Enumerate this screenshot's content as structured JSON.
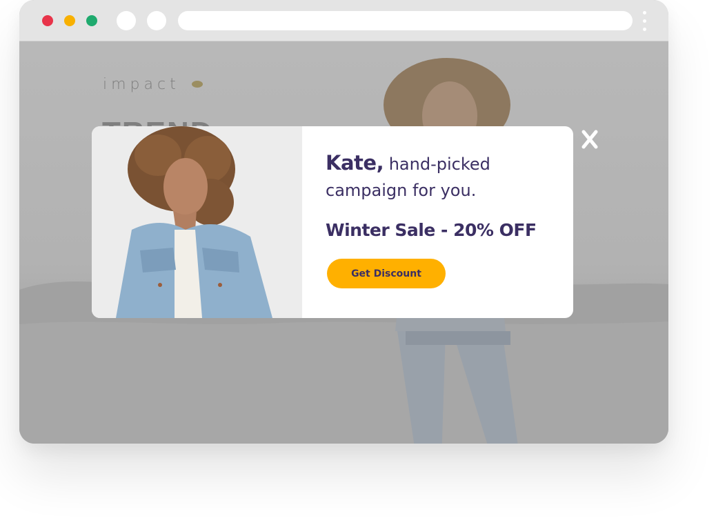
{
  "browser": {
    "traffic_lights": {
      "red": "#e8344a",
      "yellow": "#f8b000",
      "green": "#1faa6e"
    },
    "back_icon": "circle-button",
    "forward_icon": "circle-button",
    "url": "",
    "menu_icon": "kebab-menu-icon"
  },
  "background_page": {
    "logo": "impact",
    "headline": "TREND"
  },
  "popup": {
    "name": "Kate,",
    "message": " hand-picked campaign for you.",
    "offer": "Winter Sale - 20% OFF",
    "cta_label": "Get Discount",
    "close_icon": "close-icon",
    "accent_color": "#ffb000",
    "text_color": "#3b2f63"
  }
}
